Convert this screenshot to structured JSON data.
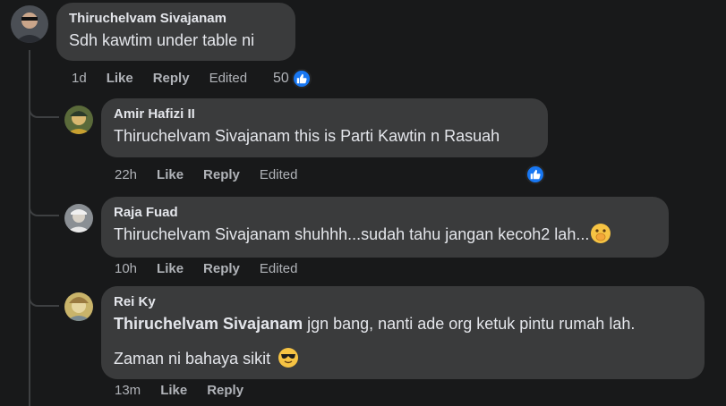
{
  "comments": [
    {
      "author": "Thiruchelvam Sivajanam",
      "text": "Sdh kawtim under table ni",
      "time": "1d",
      "like": "Like",
      "reply": "Reply",
      "edited": "Edited",
      "reactions": "50"
    },
    {
      "author": "Amir Hafizi II",
      "text": "Thiruchelvam Sivajanam this is Parti Kawtin n Rasuah",
      "time": "22h",
      "like": "Like",
      "reply": "Reply",
      "edited": "Edited"
    },
    {
      "author": "Raja Fuad",
      "text": "Thiruchelvam Sivajanam shuhhh...sudah tahu jangan kecoh2 lah...",
      "time": "10h",
      "like": "Like",
      "reply": "Reply",
      "edited": "Edited"
    },
    {
      "author": "Rei Ky",
      "mention": "Thiruchelvam Sivajanam",
      "text_line1": " jgn bang, nanti ade org ketuk pintu rumah lah.",
      "text_line2": "Zaman ni bahaya sikit",
      "time": "13m",
      "like": "Like",
      "reply": "Reply"
    }
  ],
  "icons": {
    "like_reaction": "thumbs-up-icon",
    "emoji_shush": "face-with-hand-over-mouth-emoji",
    "emoji_cool": "smiling-face-with-sunglasses-emoji"
  },
  "colors": {
    "background": "#18191a",
    "bubble": "#3a3b3c",
    "secondary_text": "#b0b3b8",
    "like_blue": "#1877f2"
  }
}
